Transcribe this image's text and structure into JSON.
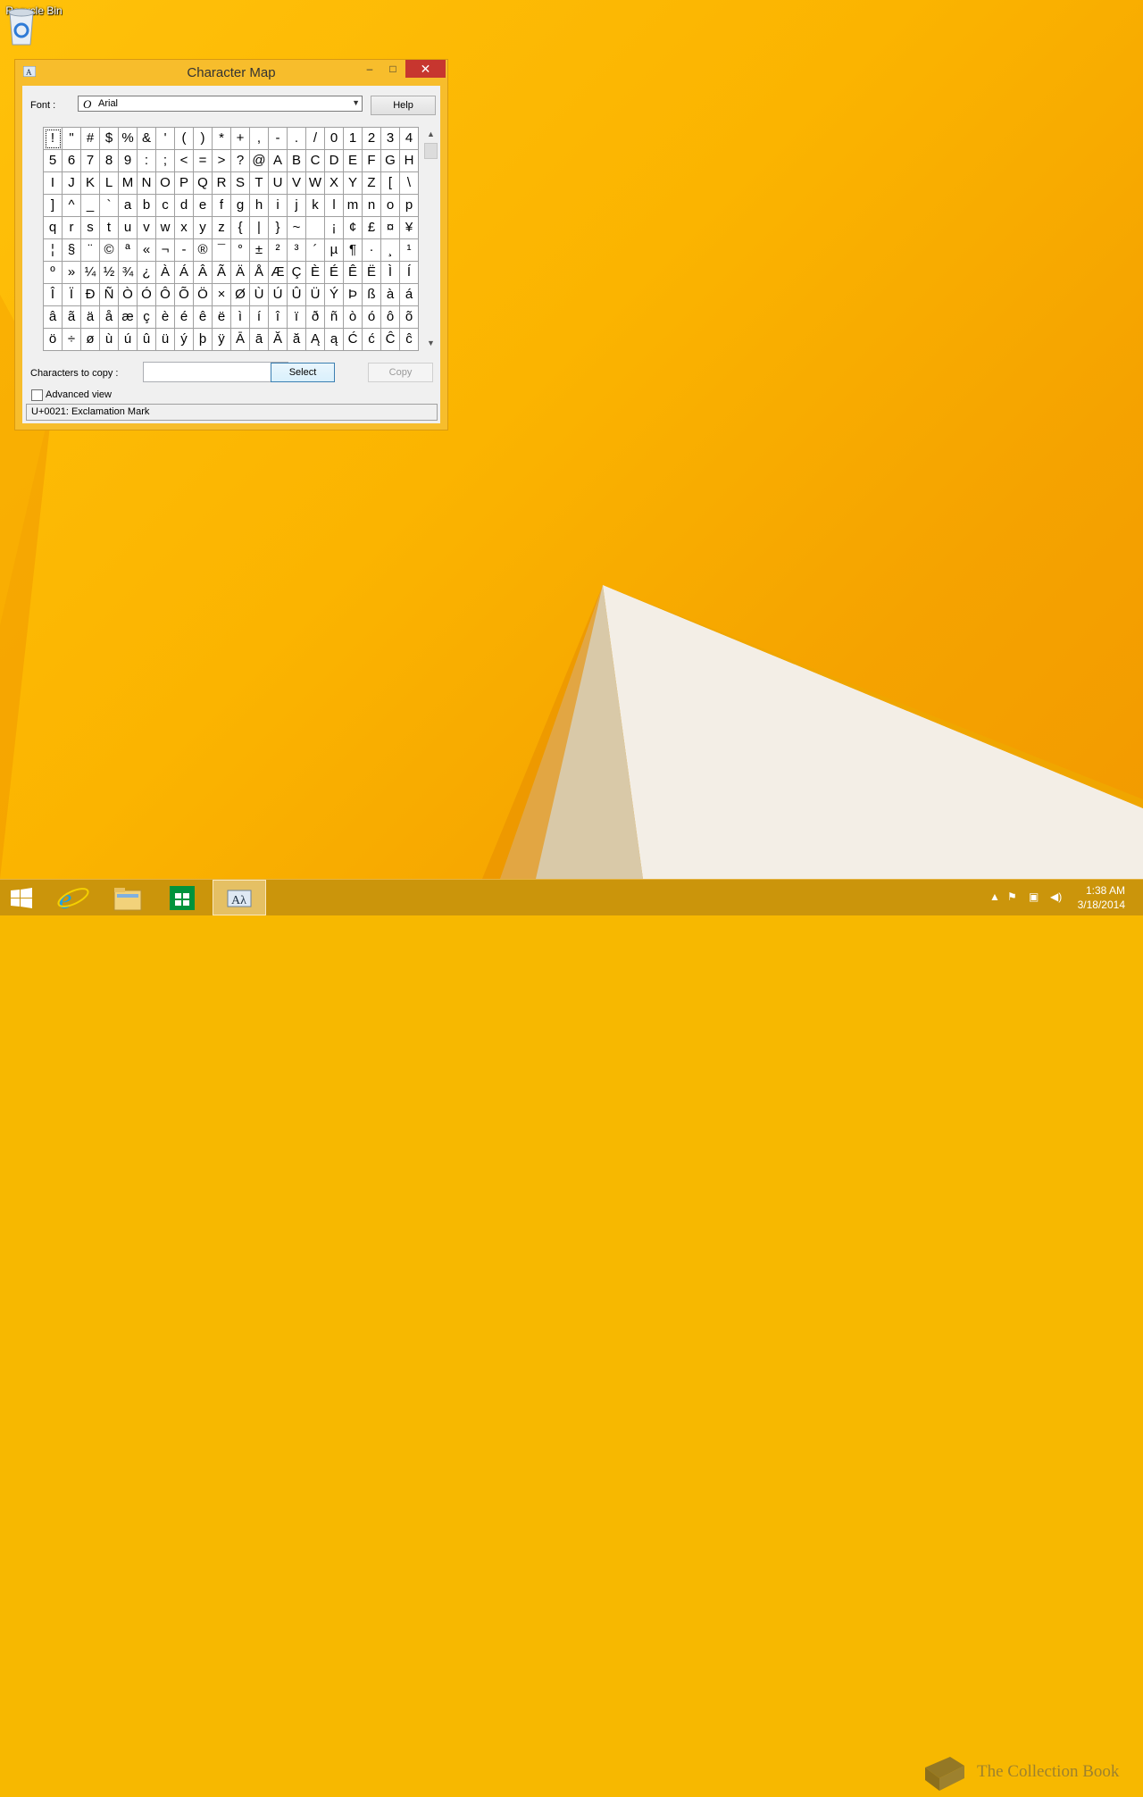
{
  "desktop": {
    "recycle_bin_label": "Recycle Bin"
  },
  "window": {
    "title": "Character Map",
    "minimize": "–",
    "maximize": "□",
    "close": "✕",
    "font_label": "Font :",
    "font_value": "Arial",
    "font_icon": "O",
    "help_label": "Help",
    "copy_label": "Characters to copy :",
    "copy_value": "",
    "select_label": "Select",
    "copy_button_label": "Copy",
    "advanced_label": "Advanced view",
    "advanced_checked": false,
    "status": "U+0021: Exclamation Mark",
    "selected_index": 0,
    "characters": [
      "!",
      "\"",
      "#",
      "$",
      "%",
      "&",
      "'",
      "(",
      ")",
      "*",
      "+",
      ",",
      "-",
      ".",
      "/",
      "0",
      "1",
      "2",
      "3",
      "4",
      "5",
      "6",
      "7",
      "8",
      "9",
      ":",
      ";",
      "<",
      "=",
      ">",
      "?",
      "@",
      "A",
      "B",
      "C",
      "D",
      "E",
      "F",
      "G",
      "H",
      "I",
      "J",
      "K",
      "L",
      "M",
      "N",
      "O",
      "P",
      "Q",
      "R",
      "S",
      "T",
      "U",
      "V",
      "W",
      "X",
      "Y",
      "Z",
      "[",
      "\\",
      "]",
      "^",
      "_",
      "`",
      "a",
      "b",
      "c",
      "d",
      "e",
      "f",
      "g",
      "h",
      "i",
      "j",
      "k",
      "l",
      "m",
      "n",
      "o",
      "p",
      "q",
      "r",
      "s",
      "t",
      "u",
      "v",
      "w",
      "x",
      "y",
      "z",
      "{",
      "|",
      "}",
      "~",
      " ",
      "¡",
      "¢",
      "£",
      "¤",
      "¥",
      "¦",
      "§",
      "¨",
      "©",
      "ª",
      "«",
      "¬",
      "-",
      "®",
      "¯",
      "°",
      "±",
      "²",
      "³",
      "´",
      "µ",
      "¶",
      "·",
      "¸",
      "¹",
      "º",
      "»",
      "¼",
      "½",
      "¾",
      "¿",
      "À",
      "Á",
      "Â",
      "Ã",
      "Ä",
      "Å",
      "Æ",
      "Ç",
      "È",
      "É",
      "Ê",
      "Ë",
      "Ì",
      "Í",
      "Î",
      "Ï",
      "Ð",
      "Ñ",
      "Ò",
      "Ó",
      "Ô",
      "Õ",
      "Ö",
      "×",
      "Ø",
      "Ù",
      "Ú",
      "Û",
      "Ü",
      "Ý",
      "Þ",
      "ß",
      "à",
      "á",
      "â",
      "ã",
      "ä",
      "å",
      "æ",
      "ç",
      "è",
      "é",
      "ê",
      "ë",
      "ì",
      "í",
      "î",
      "ï",
      "ð",
      "ñ",
      "ò",
      "ó",
      "ô",
      "õ",
      "ö",
      "÷",
      "ø",
      "ù",
      "ú",
      "û",
      "ü",
      "ý",
      "þ",
      "ÿ",
      "Ā",
      "ā",
      "Ă",
      "ă",
      "Ą",
      "ą",
      "Ć",
      "ć",
      "Ĉ",
      "ĉ"
    ]
  },
  "taskbar": {
    "items": [
      "start-button",
      "internet-explorer",
      "file-explorer",
      "store",
      "character-map"
    ],
    "time": "1:38 AM",
    "date": "3/18/2014",
    "watermark": "The Collection Book"
  }
}
